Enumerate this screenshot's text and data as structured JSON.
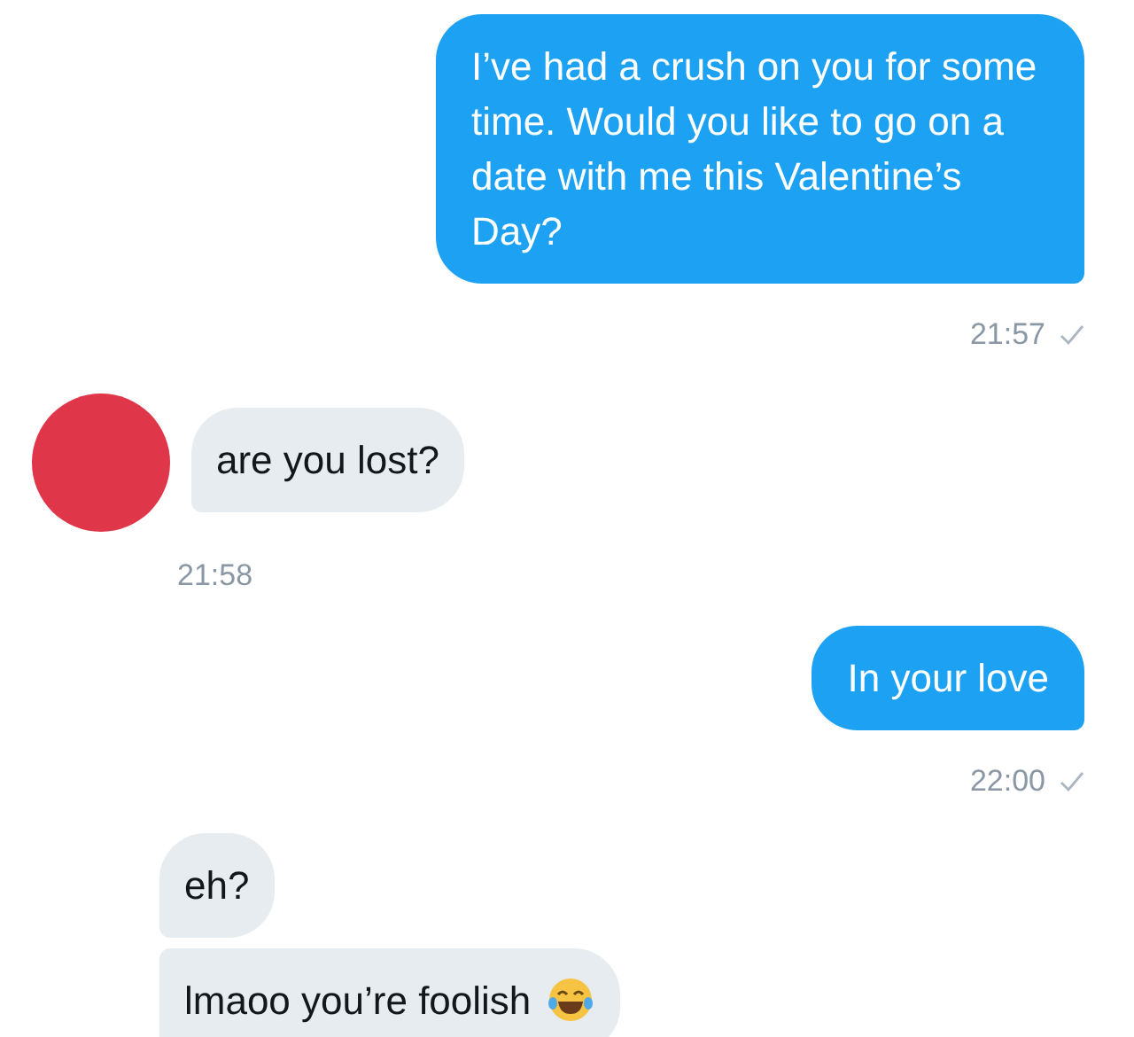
{
  "messages": [
    {
      "kind": "outgoing",
      "bubbles": [
        {
          "text": "I’ve had a crush on you for some time. Would you like to go on a date with me this Valentine’s Day?"
        }
      ],
      "time": "21:57",
      "delivered": true
    },
    {
      "kind": "incoming",
      "avatar": true,
      "bubbles": [
        {
          "text": "are you lost?"
        }
      ],
      "time": "21:58"
    },
    {
      "kind": "outgoing",
      "bubbles": [
        {
          "text": "In your love"
        }
      ],
      "time": "22:00",
      "delivered": true
    },
    {
      "kind": "incoming",
      "avatar": false,
      "bubbles": [
        {
          "text": "eh?"
        },
        {
          "text": "lmaoo you’re foolish",
          "emoji": true
        }
      ]
    }
  ]
}
